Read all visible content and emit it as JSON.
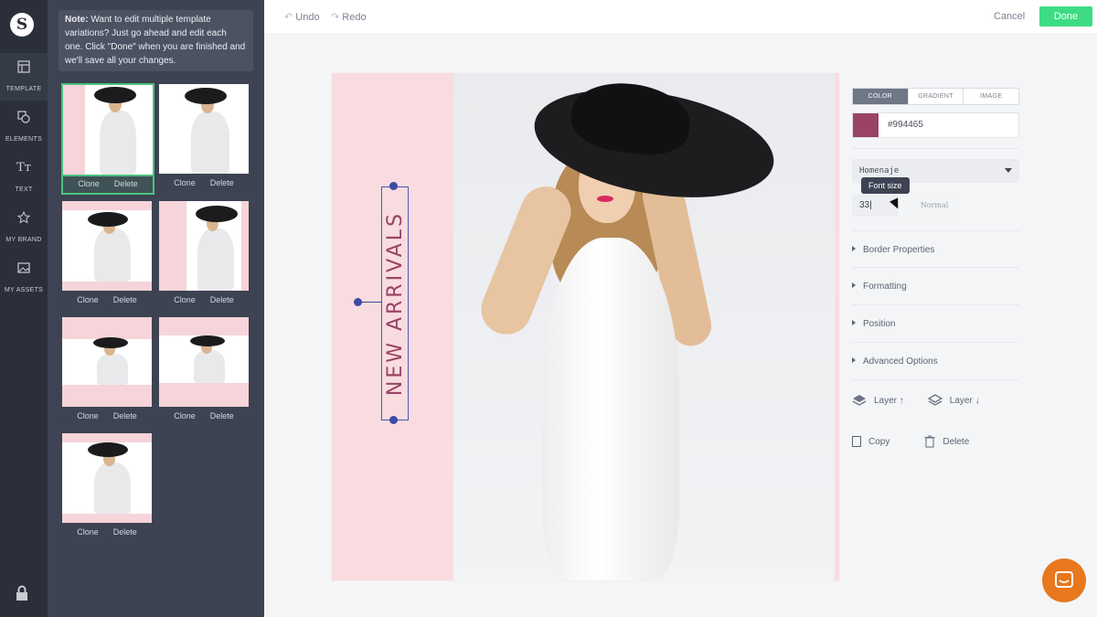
{
  "rail": {
    "logo": "S",
    "items": [
      {
        "label": "TEMPLATE",
        "icon": "template-icon"
      },
      {
        "label": "ELEMENTS",
        "icon": "elements-icon"
      },
      {
        "label": "TEXT",
        "icon": "text-icon",
        "glyph": "Tт"
      },
      {
        "label": "MY BRAND",
        "icon": "star-icon"
      },
      {
        "label": "MY ASSETS",
        "icon": "image-icon"
      }
    ],
    "lock_icon": "lock-icon"
  },
  "panel": {
    "note_bold": "Note:",
    "note_text": " Want to edit multiple template variations? Just go ahead and edit each one. Click \"Done\" when you are finished and we'll save all your changes.",
    "thumbnails": [
      {
        "clone": "Clone",
        "delete": "Delete",
        "selected": true
      },
      {
        "clone": "Clone",
        "delete": "Delete"
      },
      {
        "clone": "Clone",
        "delete": "Delete"
      },
      {
        "clone": "Clone",
        "delete": "Delete"
      },
      {
        "clone": "Clone",
        "delete": "Delete"
      },
      {
        "clone": "Clone",
        "delete": "Delete"
      },
      {
        "clone": "Clone",
        "delete": "Delete"
      }
    ]
  },
  "topbar": {
    "undo": "Undo",
    "redo": "Redo",
    "cancel": "Cancel",
    "done": "Done"
  },
  "canvas": {
    "headline": "NEW ARRIVALS",
    "text_color": "#994465"
  },
  "props": {
    "tabs": [
      "COLOR",
      "GRADIENT",
      "IMAGE"
    ],
    "active_tab": "COLOR",
    "color_hex": "#994465",
    "font": "Homenaje",
    "tooltip": "Font size",
    "font_size": "33",
    "font_weight": "Normal",
    "sections": [
      "Border Properties",
      "Formatting",
      "Position",
      "Advanced Options"
    ],
    "layer_up": "Layer ↑",
    "layer_down": "Layer ↓",
    "copy": "Copy",
    "delete": "Delete"
  }
}
